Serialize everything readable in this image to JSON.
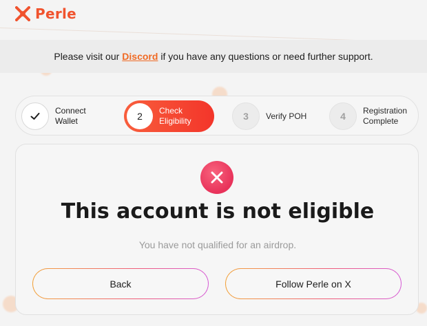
{
  "brand": {
    "name": "Perle",
    "logo_icon": "perle-logo-icon",
    "accent": "#f0532e"
  },
  "banner": {
    "text_before": "Please visit our",
    "link_label": "Discord",
    "text_after": "if you have any questions or need further support."
  },
  "steps": [
    {
      "number": "",
      "label": "Connect\nWallet",
      "state": "completed",
      "icon": "check-icon"
    },
    {
      "number": "2",
      "label": "Check\nEligibility",
      "state": "active"
    },
    {
      "number": "3",
      "label": "Verify POH",
      "state": "pending"
    },
    {
      "number": "4",
      "label": "Registration\nComplete",
      "state": "pending"
    }
  ],
  "result": {
    "icon": "close-icon",
    "icon_color": "#e8325a",
    "title": "This account is not eligible",
    "subtitle": "You have not qualified for an airdrop."
  },
  "actions": {
    "back_label": "Back",
    "follow_label": "Follow Perle on X"
  }
}
